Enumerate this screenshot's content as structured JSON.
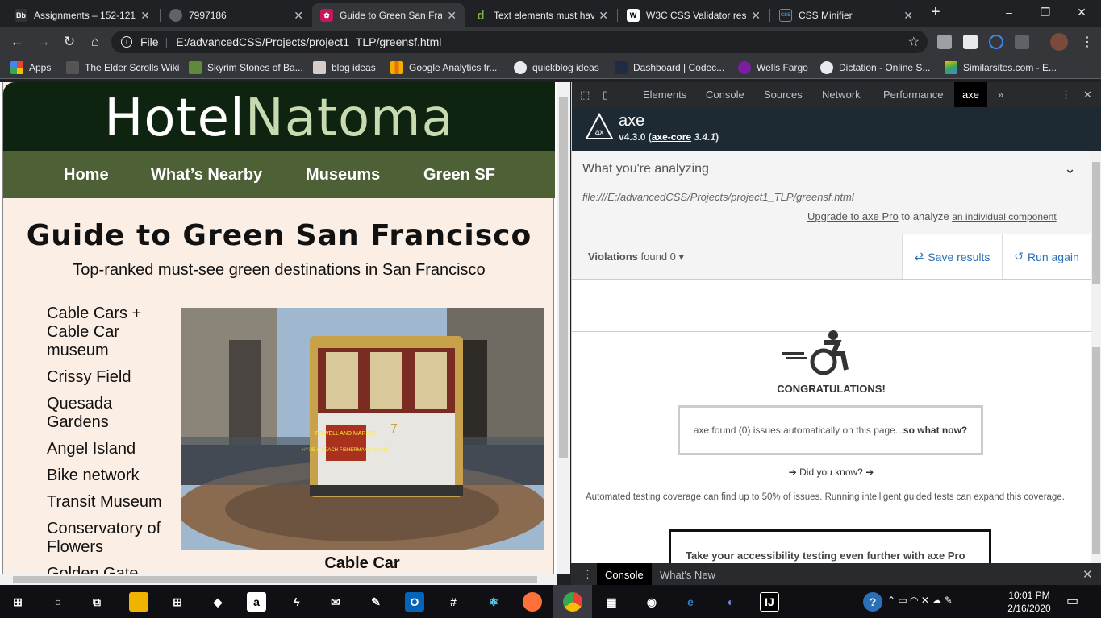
{
  "browser": {
    "tabs": [
      {
        "title": "Assignments – 152-121",
        "icon": "blackboard-icon"
      },
      {
        "title": "7997186",
        "icon": "globe-icon"
      },
      {
        "title": "Guide to Green San Fra",
        "icon": "site-favicon",
        "active": true
      },
      {
        "title": "Text elements must hav",
        "icon": "deque-icon"
      },
      {
        "title": "W3C CSS Validator resu",
        "icon": "w3c-icon"
      },
      {
        "title": "CSS Minifier",
        "icon": "css-icon"
      }
    ],
    "favicon_labels": {
      "blackboard": "Bb",
      "css": "CSS"
    },
    "new_tab": "+",
    "window_controls": {
      "minimize": "–",
      "maximize": "❐",
      "close": "✕"
    },
    "address": {
      "scheme_label": "File",
      "url": "E:/advancedCSS/Projects/project1_TLP/greensf.html"
    },
    "bookmarks": [
      {
        "label": "Apps",
        "icon": "apps-grid-icon"
      },
      {
        "label": "The Elder Scrolls Wiki",
        "icon": "elder-scrolls-icon"
      },
      {
        "label": "Skyrim Stones of Ba...",
        "icon": "skyrim-icon"
      },
      {
        "label": "blog ideas",
        "icon": "blog-icon"
      },
      {
        "label": "Google Analytics tr...",
        "icon": "analytics-icon"
      },
      {
        "label": "quickblog ideas",
        "icon": "globe-icon"
      },
      {
        "label": "Dashboard | Codec...",
        "icon": "codecademy-icon"
      },
      {
        "label": "Wells Fargo",
        "icon": "wells-fargo-icon"
      },
      {
        "label": "Dictation - Online S...",
        "icon": "globe-icon"
      },
      {
        "label": "Similarsites.com - E...",
        "icon": "similarsites-icon"
      }
    ]
  },
  "site": {
    "logo_part1": "Hotel",
    "logo_part2": "Natoma",
    "nav": [
      "Home",
      "What’s Nearby",
      "Museums",
      "Green SF"
    ],
    "title": "Guide to Green San Francisco",
    "subtitle": "Top-ranked must-see green destinations in San Francisco",
    "destinations": [
      "Cable Cars + Cable Car museum",
      "Crissy Field",
      "Quesada Gardens",
      "Angel Island",
      "Bike network",
      "Transit Museum",
      "Conservatory of Flowers",
      "Golden Gate"
    ],
    "photo_caption": "Cable Car",
    "photo_sign": "POWELL AND MARKET",
    "photo_sign2": "HYDE & BEACH FISHERMANS WHARF",
    "photo_number": "7"
  },
  "devtools": {
    "tabs": [
      "Elements",
      "Console",
      "Sources",
      "Network",
      "Performance",
      "axe"
    ],
    "more_tabs": "»",
    "axe": {
      "name": "axe",
      "version": "v4.3.0",
      "core_link": "axe-core",
      "core_version": "3.4.1",
      "analyzing_heading": "What you're analyzing",
      "analyzing_url": "file:///E:/advancedCSS/Projects/project1_TLP/greensf.html",
      "upgrade_link": "Upgrade to axe Pro",
      "upgrade_text": "to analyze",
      "component_link": "an individual component",
      "violations_label": "Violations",
      "found_label": "found 0",
      "save_label": "Save results",
      "run_label": "Run again",
      "congrats": "CONGRATULATIONS!",
      "found_text": "axe found (0) issues automatically on this page...",
      "so_what": "so what now?",
      "did_you_know": "Did you know?",
      "coverage_text": "Automated testing coverage can find up to 50% of issues. Running intelligent guided tests can expand this coverage.",
      "pro_text": "Take your accessibility testing even further with axe Pro"
    },
    "drawer_tabs": [
      "Console",
      "What's New"
    ]
  },
  "taskbar": {
    "time": "10:01 PM",
    "date": "2/16/2020"
  },
  "colors": {
    "site_header": "#0f2410",
    "site_nav": "#4d6036",
    "site_bg": "#fbeee4",
    "axe_header": "#1e2a33",
    "link_blue": "#2a6fb8"
  }
}
